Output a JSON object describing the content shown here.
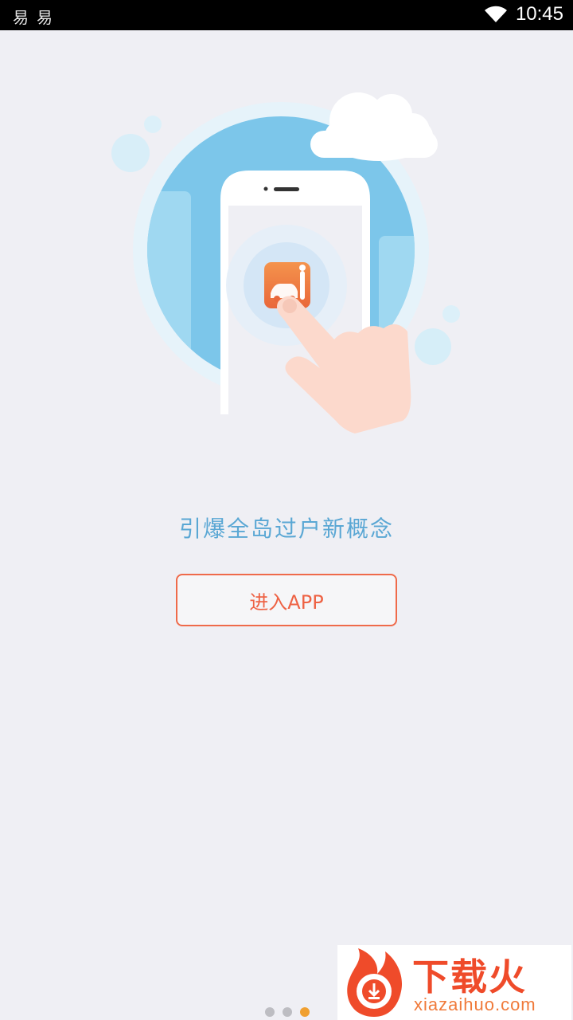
{
  "status_bar": {
    "left_icons": [
      "易",
      "易"
    ],
    "time": "10:45",
    "icons": [
      "wifi-icon"
    ]
  },
  "illustration": {
    "description_icons": [
      "cloud-icon",
      "phone-icon",
      "app-icon",
      "hand-pointer-icon"
    ],
    "colors": {
      "circle": "#7cc6ea",
      "app_icon": "#f07a3a",
      "hand": "#fcd9cc"
    }
  },
  "tagline": "引爆全岛过户新概念",
  "enter_button": {
    "label": "进入APP",
    "color": "#ee6244"
  },
  "page_indicator": {
    "count": 3,
    "active_index": 2,
    "active_color": "#f0a030"
  },
  "watermark": {
    "cn": "下载火",
    "en": "xiazaihuo.com"
  }
}
